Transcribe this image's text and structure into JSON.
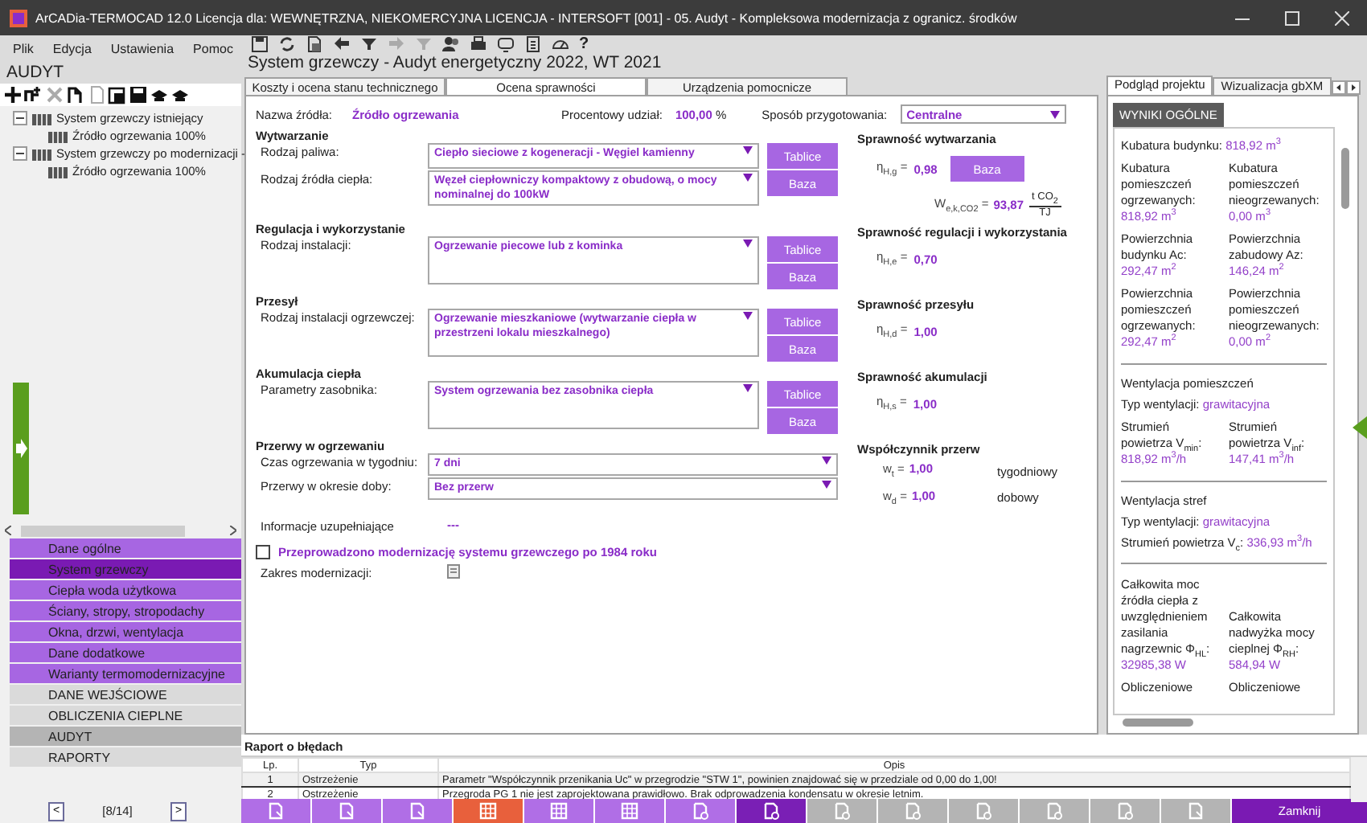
{
  "window": {
    "title": "ArCADia-TERMOCAD 12.0 Licencja dla: WEWNĘTRZNA, NIEKOMERCYJNA LICENCJA - INTERSOFT [001] - 05. Audyt - Kompleksowa modernizacja z ogranicz. środków"
  },
  "menu": [
    "Plik",
    "Edycja",
    "Ustawienia",
    "Pomoc"
  ],
  "toolbar": {
    "help": "?"
  },
  "left_panel": {
    "title": "AUDYT",
    "tree": [
      {
        "label": "System grzewczy istniejący",
        "expanded": true,
        "children": [
          {
            "label": "Źródło ogrzewania 100%"
          }
        ]
      },
      {
        "label": "System grzewczy po modernizacji -",
        "expanded": true,
        "children": [
          {
            "label": "Źródło ogrzewania 100%"
          }
        ]
      }
    ]
  },
  "nav": [
    {
      "label": "Dane ogólne",
      "kind": "module",
      "selected": false
    },
    {
      "label": "System grzewczy",
      "kind": "module",
      "selected": true
    },
    {
      "label": "Ciepła woda użytkowa",
      "kind": "module",
      "selected": false
    },
    {
      "label": "Ściany, stropy, stropodachy",
      "kind": "module",
      "selected": false
    },
    {
      "label": "Okna, drzwi, wentylacja",
      "kind": "module",
      "selected": false
    },
    {
      "label": "Dane dodatkowe",
      "kind": "module",
      "selected": false
    },
    {
      "label": "Warianty termomodernizacyjne",
      "kind": "module",
      "selected": false
    },
    {
      "label": "DANE WEJŚCIOWE",
      "kind": "section",
      "selected": false
    },
    {
      "label": "OBLICZENIA CIEPLNE",
      "kind": "section",
      "selected": false
    },
    {
      "label": "AUDYT",
      "kind": "section",
      "selected": true
    },
    {
      "label": "RAPORTY",
      "kind": "section",
      "selected": false
    }
  ],
  "pager": {
    "prev": "<",
    "position": "[8/14]",
    "next": ">"
  },
  "page_title": "System grzewczy - Audyt energetyczny 2022, WT 2021",
  "tabs": [
    {
      "label": "Koszty i ocena stanu technicznego",
      "selected": false
    },
    {
      "label": "Ocena sprawności",
      "selected": true
    },
    {
      "label": "Urządzenia pomocnicze",
      "selected": false
    }
  ],
  "form": {
    "source_name": {
      "label": "Nazwa źródła:",
      "value": "Źródło ogrzewania"
    },
    "share": {
      "label": "Procentowy udział:",
      "value": "100,00",
      "unit": "%"
    },
    "preparation": {
      "label": "Sposób przygotowania:",
      "value": "Centralne"
    },
    "sections": [
      {
        "title": "Wytwarzanie",
        "rows": [
          {
            "label": "Rodzaj paliwa:",
            "value": "Ciepło sieciowe z kogeneracji - Węgiel kamienny",
            "buttons": [
              "Tablice"
            ]
          },
          {
            "label": "Rodzaj źródła ciepła:",
            "value": "Węzeł ciepłowniczy kompaktowy z obudową, o mocy nominalnej do 100kW",
            "buttons": [
              "Baza"
            ]
          }
        ],
        "result": {
          "kind": "efficiency",
          "title": "Sprawność wytwarzania",
          "symbol": "η$_{H,g}$ =",
          "value": "0,98",
          "button": "Baza",
          "emission": {
            "symbol": "W$_{e,k,CO2}$ =",
            "value": "93,87",
            "numerator": "t CO$_{2}$",
            "denominator": "TJ"
          }
        }
      },
      {
        "title": "Regulacja i wykorzystanie",
        "rows": [
          {
            "label": "Rodzaj instalacji:",
            "value": "Ogrzewanie piecowe lub z kominka",
            "buttons": [
              "Tablice",
              "Baza"
            ]
          }
        ],
        "result": {
          "kind": "efficiency",
          "title": "Sprawność regulacji i wykorzystania",
          "symbol": "η$_{H,e}$ =",
          "value": "0,70"
        }
      },
      {
        "title": "Przesył",
        "rows": [
          {
            "label": "Rodzaj instalacji ogrzewczej:",
            "value": "Ogrzewanie mieszkaniowe (wytwarzanie ciepła w przestrzeni lokalu mieszkalnego)",
            "buttons": [
              "Tablice",
              "Baza"
            ]
          }
        ],
        "result": {
          "kind": "efficiency",
          "title": "Sprawność przesyłu",
          "symbol": "η$_{H,d}$ =",
          "value": "1,00"
        }
      },
      {
        "title": "Akumulacja ciepła",
        "rows": [
          {
            "label": "Parametry zasobnika:",
            "value": "System ogrzewania bez zasobnika ciepła",
            "buttons": [
              "Tablice",
              "Baza"
            ]
          }
        ],
        "result": {
          "kind": "efficiency",
          "title": "Sprawność akumulacji",
          "symbol": "η$_{H,s}$ =",
          "value": "1,00"
        }
      },
      {
        "title": "Przerwy w ogrzewaniu",
        "rows": [
          {
            "label": "Czas ogrzewania w tygodniu:",
            "value": "7 dni"
          },
          {
            "label": "Przerwy w okresie doby:",
            "value": "Bez przerw"
          }
        ],
        "result": {
          "kind": "factors",
          "title": "Współczynnik przerw",
          "items": [
            {
              "symbol": "w$_{t}$ =",
              "value": "1,00",
              "label": "tygodniowy"
            },
            {
              "symbol": "w$_{d}$ =",
              "value": "1,00",
              "label": "dobowy"
            }
          ]
        }
      }
    ],
    "info": {
      "label": "Informacje uzupełniające",
      "value": "---"
    },
    "modernized": {
      "label": "Przeprowadzono modernizację systemu grzewczego po 1984 roku",
      "checked": false
    },
    "scope": {
      "label": "Zakres modernizacji:"
    }
  },
  "right_panel": {
    "tabs": [
      {
        "label": "Podgląd projektu",
        "selected": true
      },
      {
        "label": "Wizualizacja gbXM",
        "selected": false
      }
    ],
    "header": "WYNIKI OGÓLNE",
    "sections": [
      {
        "items": [
          {
            "kind": "line",
            "label": "Kubatura budynku:",
            "value": "818,92 m$^{3}$"
          },
          {
            "kind": "pair",
            "cells": [
              {
                "label": "Kubatura pomieszczeń ogrzewanych:",
                "value": "818,92 m$^{3}$"
              },
              {
                "label": "Kubatura pomieszczeń nieogrzewanych:",
                "value": "0,00 m$^{3}$"
              }
            ]
          },
          {
            "kind": "pair",
            "cells": [
              {
                "label": "Powierzchnia budynku Ac:",
                "value": "292,47 m$^{2}$"
              },
              {
                "label": "Powierzchnia zabudowy Az:",
                "value": "146,24 m$^{2}$"
              }
            ]
          },
          {
            "kind": "pair",
            "cells": [
              {
                "label": "Powierzchnia pomieszczeń ogrzewanych:",
                "value": "292,47 m$^{2}$"
              },
              {
                "label": "Powierzchnia pomieszczeń nieogrzewanych:",
                "value": "0,00 m$^{2}$"
              }
            ]
          }
        ]
      },
      {
        "heading": "Wentylacja pomieszczeń",
        "items": [
          {
            "kind": "line",
            "label": "Typ wentylacji:",
            "value": "grawitacyjna"
          },
          {
            "kind": "pair",
            "cells": [
              {
                "label": "Strumień powietrza V$_{min}$:",
                "value": "818,92 m$^{3}$/h"
              },
              {
                "label": "Strumień powietrza V$_{inf}$:",
                "value": "147,41 m$^{3}$/h"
              }
            ]
          }
        ]
      },
      {
        "heading": "Wentylacja stref",
        "items": [
          {
            "kind": "line",
            "label": "Typ wentylacji:",
            "value": "grawitacyjna"
          },
          {
            "kind": "line",
            "label": "Strumień powietrza V$_{c}$:",
            "value": "336,93 m$^{3}$/h"
          }
        ]
      },
      {
        "items": [
          {
            "kind": "pair",
            "cells": [
              {
                "label": "Całkowita moc źródła ciepła z uwzględnieniem zasilania nagrzewnic Φ$_{HL}$:",
                "value": "32985,38 W"
              },
              {
                "label": "Całkowita nadwyżka mocy cieplnej Φ$_{RH}$:",
                "value": "584,94 W"
              }
            ]
          },
          {
            "kind": "pair",
            "cells": [
              {
                "label": "Obliczeniowe"
              },
              {
                "label": "Obliczeniowe"
              }
            ]
          }
        ]
      }
    ]
  },
  "error_report": {
    "title": "Raport o błędach",
    "columns": [
      "Lp.",
      "Typ",
      "Opis"
    ],
    "rows": [
      {
        "cells": [
          "1",
          "Ostrzeżenie",
          "Parametr \"Współczynnik przenikania Uc\" w przegrodzie \"STW 1\", powinien znajdować się w przedziale od 0,00 do 1,00!"
        ],
        "selected": true
      },
      {
        "cells": [
          "2",
          "Ostrzeżenie",
          "Przegroda PG 1 nie jest zaprojektowana prawidłowo. Brak odprowadzenia kondensatu w okresie letnim."
        ],
        "selected": false
      }
    ]
  },
  "bottom_toolbar": {
    "buttons": [
      {
        "kind": "page",
        "color": "#b06ee6"
      },
      {
        "kind": "page",
        "color": "#b06ee6"
      },
      {
        "kind": "page",
        "color": "#b06ee6"
      },
      {
        "kind": "table",
        "color": "#e8603c"
      },
      {
        "kind": "table",
        "color": "#b06ee6"
      },
      {
        "kind": "table",
        "color": "#b06ee6"
      },
      {
        "kind": "cycle",
        "color": "#b06ee6"
      },
      {
        "kind": "cycle",
        "color": "#7a1fb5"
      },
      {
        "kind": "cycle",
        "color": "#b4b4b4"
      },
      {
        "kind": "cycle",
        "color": "#b4b4b4"
      },
      {
        "kind": "cycle",
        "color": "#b4b4b4"
      },
      {
        "kind": "cycle",
        "color": "#b4b4b4"
      },
      {
        "kind": "cycle",
        "color": "#b4b4b4"
      },
      {
        "kind": "page",
        "color": "#b4b4b4"
      }
    ],
    "close": "Zamknij"
  }
}
